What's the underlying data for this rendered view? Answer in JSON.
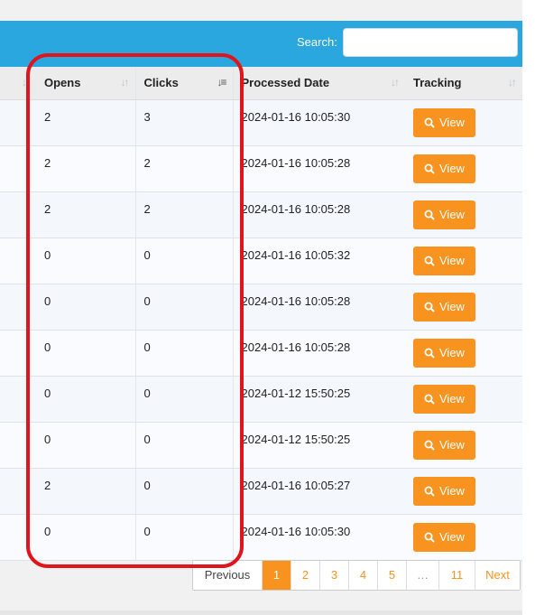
{
  "search": {
    "label": "Search:",
    "value": ""
  },
  "table": {
    "headers": {
      "opens": "Opens",
      "clicks": "Clicks",
      "processed": "Processed Date",
      "tracking": "Tracking"
    },
    "rows": [
      {
        "opens": "2",
        "clicks": "3",
        "date": "2024-01-16 10:05:30",
        "action": "View"
      },
      {
        "opens": "2",
        "clicks": "2",
        "date": "2024-01-16 10:05:28",
        "action": "View"
      },
      {
        "opens": "2",
        "clicks": "2",
        "date": "2024-01-16 10:05:28",
        "action": "View"
      },
      {
        "opens": "0",
        "clicks": "0",
        "date": "2024-01-16 10:05:32",
        "action": "View"
      },
      {
        "opens": "0",
        "clicks": "0",
        "date": "2024-01-16 10:05:28",
        "action": "View"
      },
      {
        "opens": "0",
        "clicks": "0",
        "date": "2024-01-16 10:05:28",
        "action": "View"
      },
      {
        "opens": "0",
        "clicks": "0",
        "date": "2024-01-12 15:50:25",
        "action": "View"
      },
      {
        "opens": "0",
        "clicks": "0",
        "date": "2024-01-12 15:50:25",
        "action": "View"
      },
      {
        "opens": "2",
        "clicks": "0",
        "date": "2024-01-16 10:05:27",
        "action": "View"
      },
      {
        "opens": "0",
        "clicks": "0",
        "date": "2024-01-16 10:05:30",
        "action": "View"
      }
    ]
  },
  "pagination": {
    "previous": "Previous",
    "pages": [
      "1",
      "2",
      "3",
      "4",
      "5",
      "…",
      "11"
    ],
    "current": "1",
    "next": "Next"
  },
  "colors": {
    "header_bar": "#2aa7df",
    "button": "#f7931e",
    "highlight": "#e0141a"
  },
  "icons": {
    "sort": "sort-both-icon",
    "sort_active": "sort-desc-icon",
    "search": "search-icon"
  }
}
